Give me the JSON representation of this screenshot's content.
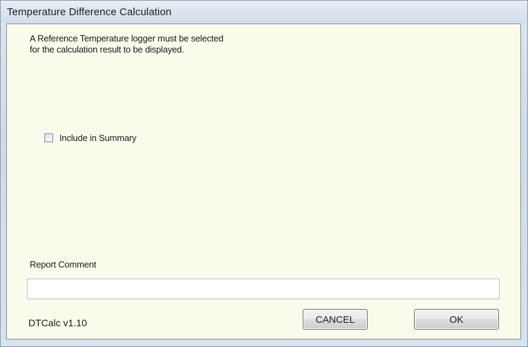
{
  "window": {
    "title": "Temperature Difference Calculation"
  },
  "message": {
    "line1": "A Reference Temperature logger must be selected",
    "line2": "for the calculation result to be displayed."
  },
  "include_summary": {
    "label": "Include in Summary",
    "checked": false
  },
  "report_comment": {
    "label": "Report Comment",
    "value": "",
    "placeholder": ""
  },
  "footer": {
    "version": "DTCalc v1.10",
    "cancel_label": "CANCEL",
    "ok_label": "OK"
  },
  "colors": {
    "client_background": "#fbfbec",
    "title_background": "#dbe5ee"
  }
}
